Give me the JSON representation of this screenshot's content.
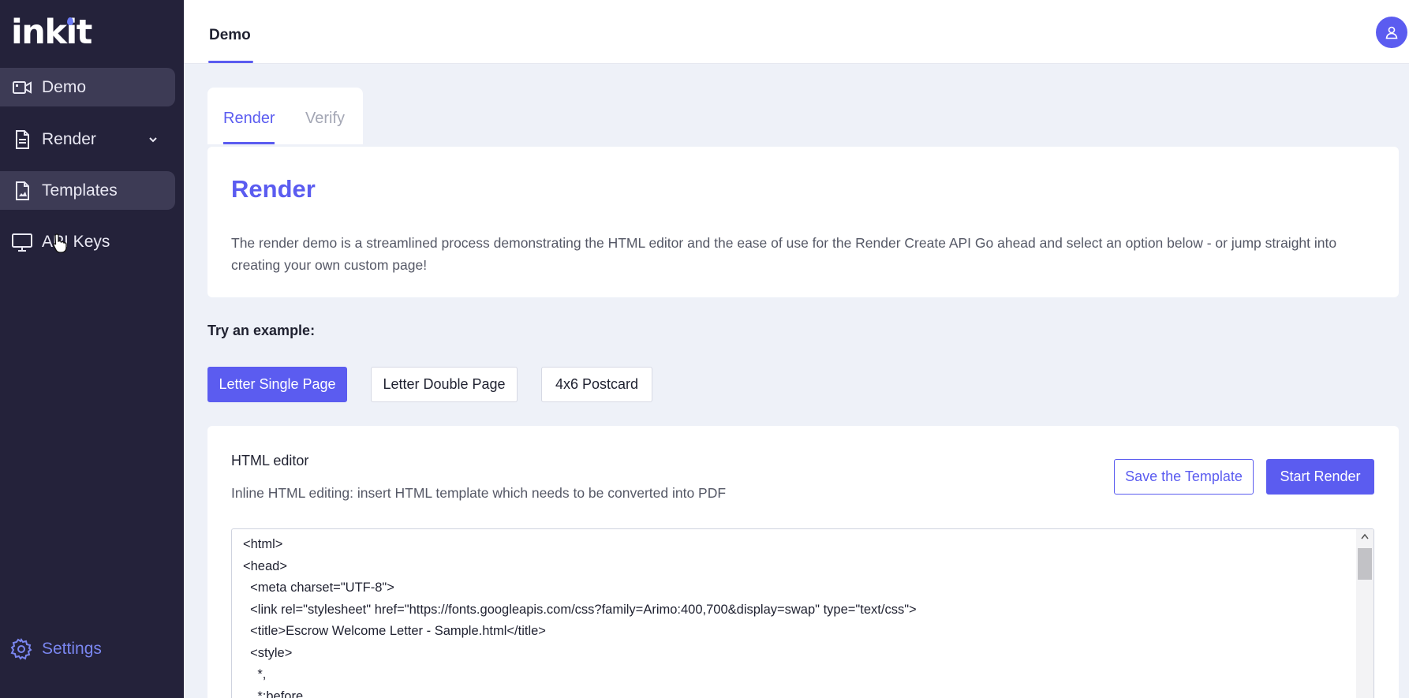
{
  "brand": {
    "logo_text": "inkit"
  },
  "sidebar": {
    "items": [
      {
        "label": "Demo",
        "icon": "video-icon",
        "active": true
      },
      {
        "label": "Render",
        "icon": "document-icon",
        "active": false,
        "expandable": true
      },
      {
        "label": "Templates",
        "icon": "image-file-icon",
        "active": true
      },
      {
        "label": "API Keys",
        "icon": "monitor-icon",
        "active": false
      }
    ],
    "settings_label": "Settings"
  },
  "topbar": {
    "tab_label": "Demo",
    "avatar_icon": "user-icon"
  },
  "tabs": {
    "render_label": "Render",
    "verify_label": "Verify",
    "active": "Render"
  },
  "intro": {
    "title": "Render",
    "description": "The render demo is a streamlined process demonstrating the HTML editor and the ease of use for the Render Create API Go ahead and select an option below - or jump straight into creating your own custom page!"
  },
  "examples": {
    "label": "Try an example:",
    "buttons": [
      "Letter Single Page",
      "Letter Double Page",
      "4x6 Postcard"
    ],
    "selected": "Letter Single Page"
  },
  "editor": {
    "title": "HTML editor",
    "subtitle": "Inline HTML editing: insert HTML template which needs to be converted into PDF",
    "save_label": "Save the Template",
    "start_label": "Start Render",
    "code_lines": [
      "<html>",
      "<head>",
      "  <meta charset=\"UTF-8\">",
      "  <link rel=\"stylesheet\" href=\"https://fonts.googleapis.com/css?family=Arimo:400,700&display=swap\" type=\"text/css\">",
      "  <title>Escrow Welcome Letter - Sample.html</title>",
      "  <style>",
      "    *,",
      "    *:before,"
    ]
  },
  "colors": {
    "accent": "#5b5cf0",
    "sidebar_bg": "#24223a",
    "sidebar_active": "#3d3b55",
    "page_bg": "#eef1f8"
  }
}
